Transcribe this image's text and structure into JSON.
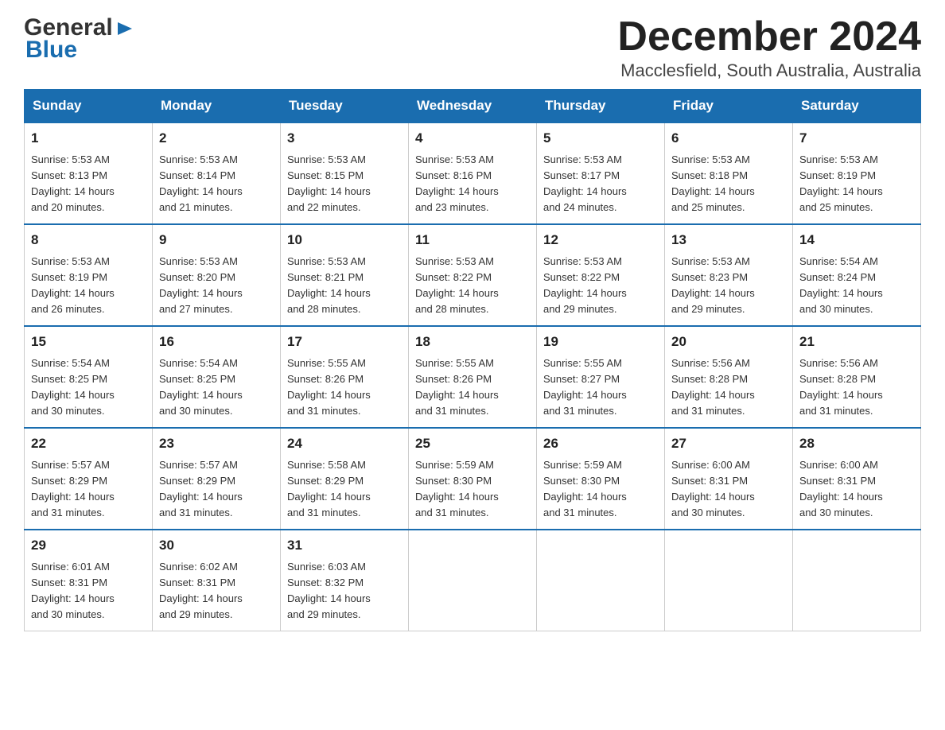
{
  "header": {
    "logo": {
      "general": "General",
      "blue": "Blue"
    },
    "month_title": "December 2024",
    "location": "Macclesfield, South Australia, Australia"
  },
  "days_of_week": [
    "Sunday",
    "Monday",
    "Tuesday",
    "Wednesday",
    "Thursday",
    "Friday",
    "Saturday"
  ],
  "weeks": [
    [
      {
        "day": "1",
        "sunrise": "5:53 AM",
        "sunset": "8:13 PM",
        "daylight": "14 hours and 20 minutes."
      },
      {
        "day": "2",
        "sunrise": "5:53 AM",
        "sunset": "8:14 PM",
        "daylight": "14 hours and 21 minutes."
      },
      {
        "day": "3",
        "sunrise": "5:53 AM",
        "sunset": "8:15 PM",
        "daylight": "14 hours and 22 minutes."
      },
      {
        "day": "4",
        "sunrise": "5:53 AM",
        "sunset": "8:16 PM",
        "daylight": "14 hours and 23 minutes."
      },
      {
        "day": "5",
        "sunrise": "5:53 AM",
        "sunset": "8:17 PM",
        "daylight": "14 hours and 24 minutes."
      },
      {
        "day": "6",
        "sunrise": "5:53 AM",
        "sunset": "8:18 PM",
        "daylight": "14 hours and 25 minutes."
      },
      {
        "day": "7",
        "sunrise": "5:53 AM",
        "sunset": "8:19 PM",
        "daylight": "14 hours and 25 minutes."
      }
    ],
    [
      {
        "day": "8",
        "sunrise": "5:53 AM",
        "sunset": "8:19 PM",
        "daylight": "14 hours and 26 minutes."
      },
      {
        "day": "9",
        "sunrise": "5:53 AM",
        "sunset": "8:20 PM",
        "daylight": "14 hours and 27 minutes."
      },
      {
        "day": "10",
        "sunrise": "5:53 AM",
        "sunset": "8:21 PM",
        "daylight": "14 hours and 28 minutes."
      },
      {
        "day": "11",
        "sunrise": "5:53 AM",
        "sunset": "8:22 PM",
        "daylight": "14 hours and 28 minutes."
      },
      {
        "day": "12",
        "sunrise": "5:53 AM",
        "sunset": "8:22 PM",
        "daylight": "14 hours and 29 minutes."
      },
      {
        "day": "13",
        "sunrise": "5:53 AM",
        "sunset": "8:23 PM",
        "daylight": "14 hours and 29 minutes."
      },
      {
        "day": "14",
        "sunrise": "5:54 AM",
        "sunset": "8:24 PM",
        "daylight": "14 hours and 30 minutes."
      }
    ],
    [
      {
        "day": "15",
        "sunrise": "5:54 AM",
        "sunset": "8:25 PM",
        "daylight": "14 hours and 30 minutes."
      },
      {
        "day": "16",
        "sunrise": "5:54 AM",
        "sunset": "8:25 PM",
        "daylight": "14 hours and 30 minutes."
      },
      {
        "day": "17",
        "sunrise": "5:55 AM",
        "sunset": "8:26 PM",
        "daylight": "14 hours and 31 minutes."
      },
      {
        "day": "18",
        "sunrise": "5:55 AM",
        "sunset": "8:26 PM",
        "daylight": "14 hours and 31 minutes."
      },
      {
        "day": "19",
        "sunrise": "5:55 AM",
        "sunset": "8:27 PM",
        "daylight": "14 hours and 31 minutes."
      },
      {
        "day": "20",
        "sunrise": "5:56 AM",
        "sunset": "8:28 PM",
        "daylight": "14 hours and 31 minutes."
      },
      {
        "day": "21",
        "sunrise": "5:56 AM",
        "sunset": "8:28 PM",
        "daylight": "14 hours and 31 minutes."
      }
    ],
    [
      {
        "day": "22",
        "sunrise": "5:57 AM",
        "sunset": "8:29 PM",
        "daylight": "14 hours and 31 minutes."
      },
      {
        "day": "23",
        "sunrise": "5:57 AM",
        "sunset": "8:29 PM",
        "daylight": "14 hours and 31 minutes."
      },
      {
        "day": "24",
        "sunrise": "5:58 AM",
        "sunset": "8:29 PM",
        "daylight": "14 hours and 31 minutes."
      },
      {
        "day": "25",
        "sunrise": "5:59 AM",
        "sunset": "8:30 PM",
        "daylight": "14 hours and 31 minutes."
      },
      {
        "day": "26",
        "sunrise": "5:59 AM",
        "sunset": "8:30 PM",
        "daylight": "14 hours and 31 minutes."
      },
      {
        "day": "27",
        "sunrise": "6:00 AM",
        "sunset": "8:31 PM",
        "daylight": "14 hours and 30 minutes."
      },
      {
        "day": "28",
        "sunrise": "6:00 AM",
        "sunset": "8:31 PM",
        "daylight": "14 hours and 30 minutes."
      }
    ],
    [
      {
        "day": "29",
        "sunrise": "6:01 AM",
        "sunset": "8:31 PM",
        "daylight": "14 hours and 30 minutes."
      },
      {
        "day": "30",
        "sunrise": "6:02 AM",
        "sunset": "8:31 PM",
        "daylight": "14 hours and 29 minutes."
      },
      {
        "day": "31",
        "sunrise": "6:03 AM",
        "sunset": "8:32 PM",
        "daylight": "14 hours and 29 minutes."
      },
      null,
      null,
      null,
      null
    ]
  ],
  "labels": {
    "sunrise": "Sunrise:",
    "sunset": "Sunset:",
    "daylight": "Daylight:"
  }
}
